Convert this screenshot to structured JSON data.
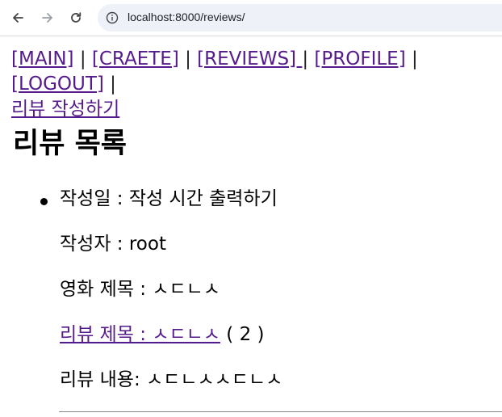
{
  "browser": {
    "url": "localhost:8000/reviews/"
  },
  "nav": {
    "links": [
      "[MAIN]",
      "[CRAETE]",
      "[REVIEWS] ",
      "[PROFILE]",
      "[LOGOUT]"
    ],
    "separator": "|",
    "write_review": "리뷰 작성하기"
  },
  "page": {
    "title": "리뷰 목록"
  },
  "review": {
    "created_label": "작성일 : 작성 시간 출력하기",
    "author_label": "작성자 : root",
    "movie_label": "영화 제목 : ㅅㄷㄴㅅ",
    "review_title_link": "리뷰 제목 : ㅅㄷㄴㅅ",
    "review_count": " ( 2 )",
    "content_label": "리뷰 내용: ㅅㄷㄴㅅㅅㄷㄴㅅ"
  }
}
